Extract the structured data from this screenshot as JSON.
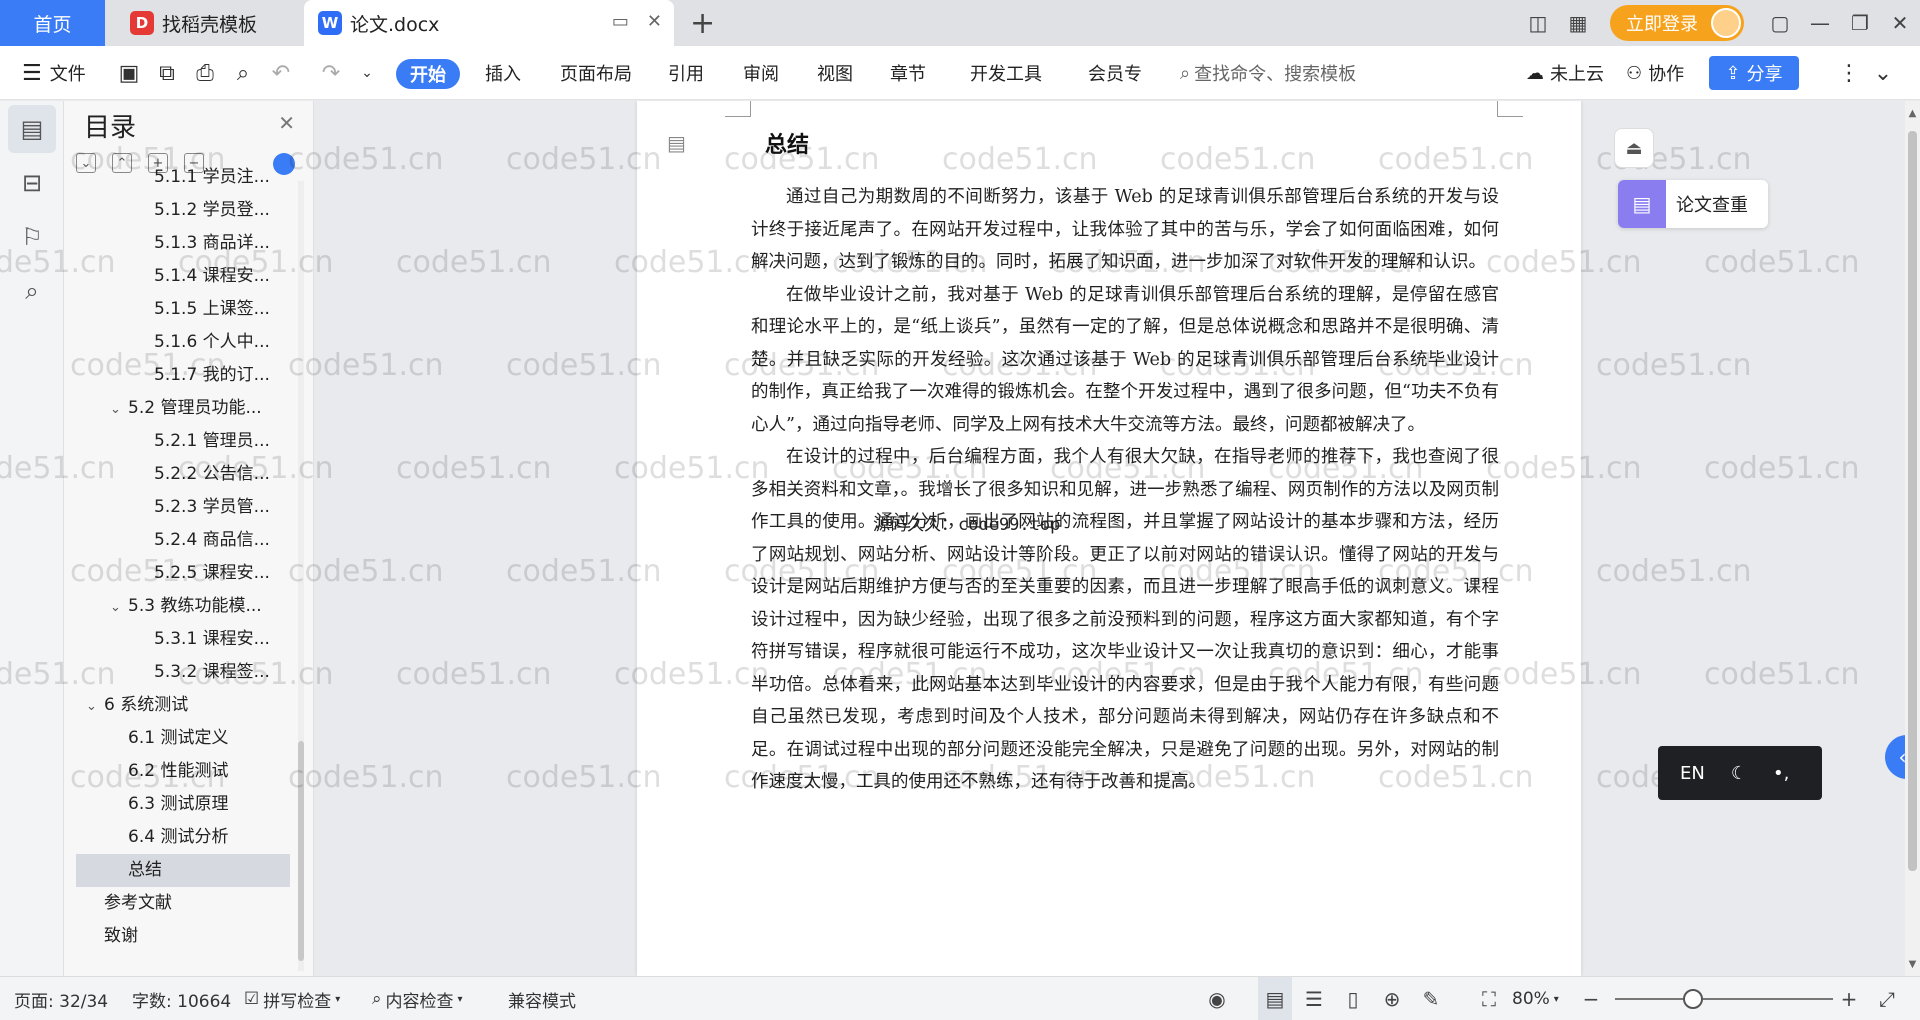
{
  "titlebar": {
    "home_tab": "首页",
    "tab1": "找稻壳模板",
    "tab2": "论文.docx",
    "login": "立即登录"
  },
  "toolbar": {
    "file": "文件",
    "start": "开始",
    "insert": "插入",
    "layout": "页面布局",
    "references": "引用",
    "review": "审阅",
    "view": "视图",
    "chapter": "章节",
    "dev_tools": "开发工具",
    "member": "会员专",
    "search_placeholder": "查找命令、搜索模板",
    "cloud": "未上云",
    "collab": "协作",
    "share": "分享"
  },
  "toc": {
    "title": "目录",
    "items": [
      {
        "text": "5.1.1 学员注...",
        "level": 3
      },
      {
        "text": "5.1.2 学员登...",
        "level": 3
      },
      {
        "text": "5.1.3 商品详...",
        "level": 3
      },
      {
        "text": "5.1.4 课程安...",
        "level": 3
      },
      {
        "text": "5.1.5 上课签...",
        "level": 3
      },
      {
        "text": "5.1.6 个人中...",
        "level": 3
      },
      {
        "text": "5.1.7 我的订...",
        "level": 3
      },
      {
        "text": "5.2 管理员功能...",
        "level": 2
      },
      {
        "text": "5.2.1 管理员...",
        "level": 3
      },
      {
        "text": "5.2.2 公告信...",
        "level": 3
      },
      {
        "text": "5.2.3 学员管...",
        "level": 3
      },
      {
        "text": "5.2.4 商品信...",
        "level": 3
      },
      {
        "text": "5.2.5 课程安...",
        "level": 3
      },
      {
        "text": "5.3 教练功能模...",
        "level": 2
      },
      {
        "text": "5.3.1 课程安...",
        "level": 3
      },
      {
        "text": "5.3.2 课程签...",
        "level": 3
      },
      {
        "text": "6  系统测试",
        "level": 1
      },
      {
        "text": "6.1  测试定义",
        "level": 2
      },
      {
        "text": "6.2  性能测试",
        "level": 2
      },
      {
        "text": "6.3  测试原理",
        "level": 2
      },
      {
        "text": "6.4  测试分析",
        "level": 2
      },
      {
        "text": "总结",
        "level": 0
      },
      {
        "text": "参考文献",
        "level": 1
      },
      {
        "text": "致谢",
        "level": 1
      }
    ]
  },
  "document": {
    "heading": "总结",
    "paragraphs": [
      "通过自己为期数周的不间断努力，该基于 Web 的足球青训俱乐部管理后台系统的开发与设计终于接近尾声了。在网站开发过程中，让我体验了其中的苦与乐，学会了如何面临困难，如何解决问题，达到了锻炼的目的。同时，拓展了知识面，进一步加深了对软件开发的理解和认识。",
      "在做毕业设计之前，我对基于 Web 的足球青训俱乐部管理后台系统的理解，是停留在感官和理论水平上的，是“纸上谈兵”，虽然有一定的了解，但是总体说概念和思路并不是很明确、清楚。并且缺乏实际的开发经验。这次通过该基于 Web 的足球青训俱乐部管理后台系统毕业设计的制作，真正给我了一次难得的锻炼机会。在整个开发过程中，遇到了很多问题，但“功夫不负有心人”，通过向指导老师、同学及上网有技术大牛交流等方法。最终，问题都被解决了。",
      "在设计的过程中，后台编程方面，我个人有很大欠缺，在指导老师的推荐下，我也查阅了很多相关资料和文章，。我增长了很多知识和见解，进一步熟悉了编程、网页制作的方法以及网页制作工具的使用。通过分析，画出了网站的流程图，并且掌握了网站设计的基本步骤和方法，经历了网站规划、网站分析、网站设计等阶段。更正了以前对网站的错误认识。懂得了网站的开发与设计是网站后期维护方便与否的至关重要的因素，而且进一步理解了眼高手低的讽刺意义。课程设计过程中，因为缺少经验，出现了很多之前没预料到的问题，程序这方面大家都知道，有个字符拼写错误，程序就很可能运行不成功，这次毕业设计又一次让我真切的意识到：细心，才能事半功倍。总体看来，此网站基本达到毕业设计的内容要求，但是由于我个人能力有限，有些问题自己虽然已发现，考虑到时间及个人技术，部分问题尚未得到解决，网站仍存在许多缺点和不足。在调试过程中出现的部分问题还没能完全解决，只是避免了问题的出现。另外，对网站的制作速度太慢，工具的使用还不熟练，还有待于改善和提高。"
    ],
    "overlay": "源码久久：code99.top",
    "watermark": "code51.cn"
  },
  "widgets": {
    "paper_check": "论文查重",
    "ime_lang": "EN"
  },
  "status": {
    "page": "页面: 32/34",
    "words": "字数: 10664",
    "spell": "拼写检查",
    "content_check": "内容检查",
    "compat": "兼容模式",
    "zoom": "80%"
  },
  "colors": {
    "accent": "#3a7bf6",
    "login": "#f7a21c"
  }
}
